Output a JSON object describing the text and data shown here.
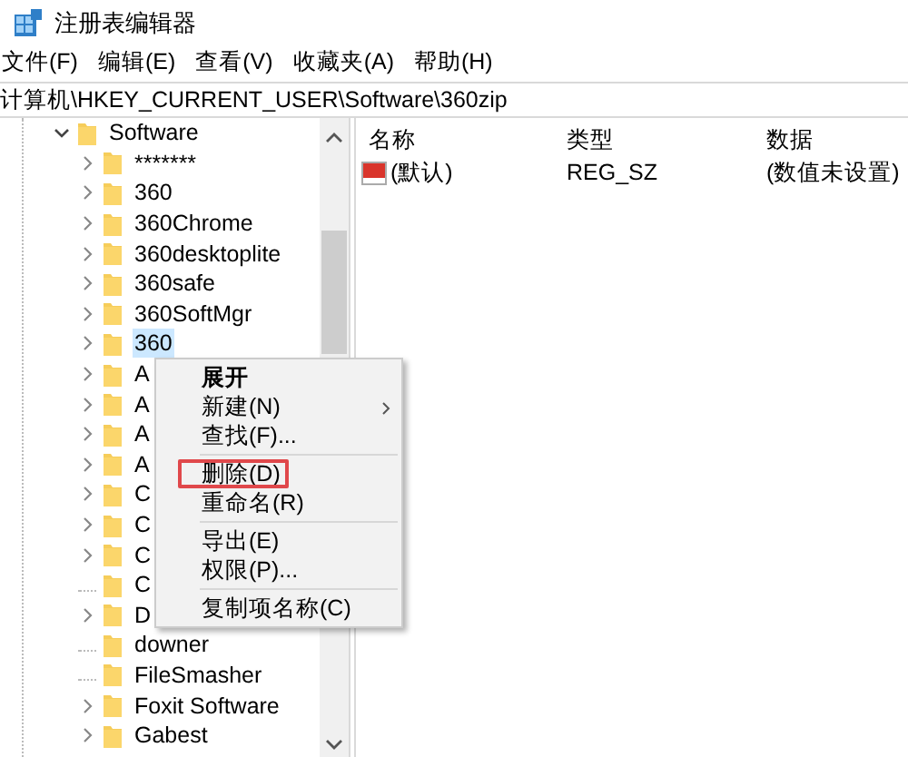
{
  "window": {
    "title": "注册表编辑器"
  },
  "menu_bar": [
    "文件(F)",
    "编辑(E)",
    "查看(V)",
    "收藏夹(A)",
    "帮助(H)"
  ],
  "address": "计算机\\HKEY_CURRENT_USER\\Software\\360zip",
  "tree": [
    {
      "label": "Software",
      "expanded": true,
      "has_children": true,
      "selected": false,
      "children": [
        {
          "label": "*******",
          "has_children": true,
          "selected": false
        },
        {
          "label": "360",
          "has_children": true,
          "selected": false
        },
        {
          "label": "360Chrome",
          "has_children": true,
          "selected": false
        },
        {
          "label": "360desktoplite",
          "has_children": true,
          "selected": false
        },
        {
          "label": "360safe",
          "has_children": true,
          "selected": false
        },
        {
          "label": "360SoftMgr",
          "has_children": true,
          "selected": false
        },
        {
          "label": "360",
          "has_children": true,
          "selected": true
        },
        {
          "label": "A",
          "has_children": true,
          "selected": false
        },
        {
          "label": "A",
          "has_children": true,
          "selected": false
        },
        {
          "label": "A",
          "has_children": true,
          "selected": false
        },
        {
          "label": "A",
          "has_children": true,
          "selected": false
        },
        {
          "label": "C",
          "has_children": true,
          "selected": false
        },
        {
          "label": "C",
          "has_children": true,
          "selected": false
        },
        {
          "label": "C",
          "has_children": true,
          "selected": false
        },
        {
          "label": "C",
          "has_children": false,
          "selected": false
        },
        {
          "label": "D",
          "has_children": true,
          "selected": false
        },
        {
          "label": "downer",
          "has_children": false,
          "selected": false
        },
        {
          "label": "FileSmasher",
          "has_children": false,
          "selected": false
        },
        {
          "label": "Foxit Software",
          "has_children": true,
          "selected": false
        },
        {
          "label": "Gabest",
          "has_children": true,
          "selected": false
        }
      ]
    }
  ],
  "list": {
    "columns": [
      "名称",
      "类型",
      "数据"
    ],
    "rows": [
      {
        "name": "(默认)",
        "type": "REG_SZ",
        "data": "(数值未设置)"
      }
    ]
  },
  "context_menu": [
    {
      "label": "展开",
      "kind": "default"
    },
    {
      "label": "新建(N)",
      "kind": "submenu"
    },
    {
      "label": "查找(F)...",
      "kind": "item"
    },
    {
      "kind": "separator"
    },
    {
      "label": "删除(D)",
      "kind": "item",
      "highlighted": true
    },
    {
      "label": "重命名(R)",
      "kind": "item"
    },
    {
      "kind": "separator"
    },
    {
      "label": "导出(E)",
      "kind": "item"
    },
    {
      "label": "权限(P)...",
      "kind": "item"
    },
    {
      "kind": "separator"
    },
    {
      "label": "复制项名称(C)",
      "kind": "item"
    }
  ]
}
